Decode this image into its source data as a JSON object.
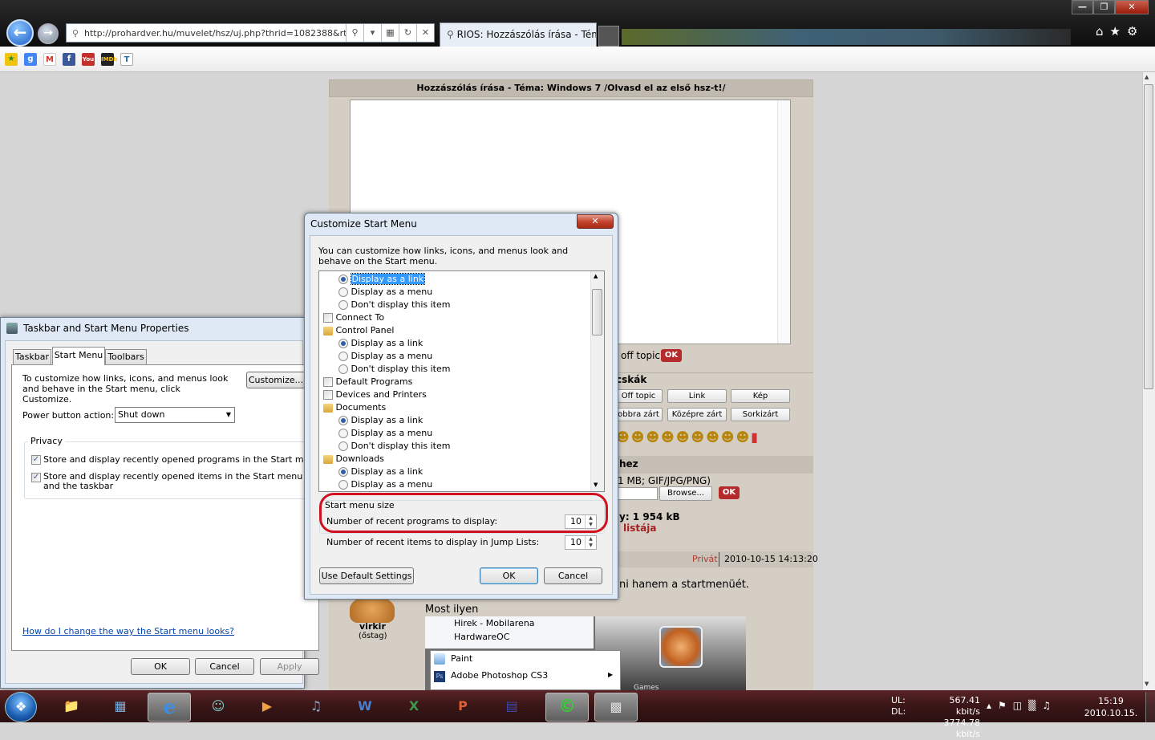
{
  "browser": {
    "address": "http://prohardver.hu/muvelet/hsz/uj.php?thrid=1082388&rto",
    "tab_title": "RIOS: Hozzászólás írása - Tém...",
    "window_buttons": [
      "—",
      "❐",
      "✕"
    ],
    "favorites": [
      "star-add-icon",
      "google-icon",
      "gmail-icon",
      "facebook-icon",
      "youtube-icon",
      "imdb-icon",
      "t-icon"
    ]
  },
  "forum": {
    "header": "Hozzászólás írása - Téma: Windows 7 /Olvasd el az első hsz-t!/",
    "offtopic_label": "off topic",
    "ok": "OK",
    "section1": "cskák",
    "buttons_row1": [
      "Off topic",
      "Link",
      "Kép"
    ],
    "buttons_row2": [
      "obbra zárt",
      "Középre zárt",
      "Sorkizárt"
    ],
    "section2": "hez",
    "upload_hint": "1 MB; GIF/JPG/PNG)",
    "browse": "Browse...",
    "size_label": "y: 1 954 kB",
    "list_link": "listája",
    "privat": "Privát",
    "timestamp": "2010-10-15 14:13:20",
    "post_text": "ni hanem a startmenüét.",
    "post_text2": "Most ilyen",
    "username": "virkir",
    "usertitle": "(őstag)",
    "menu_items_top": [
      "Hirek - Mobilarena",
      "HardwareOC"
    ],
    "menu_items": [
      "Paint",
      "Adobe Photoshop CS3"
    ],
    "games": "Games"
  },
  "taskbar_props": {
    "title": "Taskbar and Start Menu Properties",
    "tabs": [
      "Taskbar",
      "Start Menu",
      "Toolbars"
    ],
    "desc": "To customize how links, icons, and menus look and behave in the Start menu, click Customize.",
    "customize": "Customize...",
    "power_label": "Power button action:",
    "power_value": "Shut down",
    "privacy": "Privacy",
    "privacy1": "Store and display recently opened programs in the Start menu",
    "privacy2": "Store and display recently opened items in the Start menu and the taskbar",
    "help_link": "How do I change the way the Start menu looks?",
    "ok": "OK",
    "cancel": "Cancel",
    "apply": "Apply"
  },
  "customize": {
    "title": "Customize Start Menu",
    "close": "✕",
    "desc": "You can customize how links, icons, and menus look and behave on the Start menu.",
    "list": [
      {
        "type": "radio",
        "on": true,
        "label": "Display as a link",
        "sel": true
      },
      {
        "type": "radio",
        "on": false,
        "label": "Display as a menu"
      },
      {
        "type": "radio",
        "on": false,
        "label": "Don't display this item"
      },
      {
        "type": "check",
        "on": false,
        "label": "Connect To"
      },
      {
        "type": "icon",
        "label": "Control Panel"
      },
      {
        "type": "radio",
        "on": true,
        "label": "Display as a link"
      },
      {
        "type": "radio",
        "on": false,
        "label": "Display as a menu"
      },
      {
        "type": "radio",
        "on": false,
        "label": "Don't display this item"
      },
      {
        "type": "check",
        "on": false,
        "label": "Default Programs"
      },
      {
        "type": "check",
        "on": false,
        "label": "Devices and Printers"
      },
      {
        "type": "icon",
        "label": "Documents"
      },
      {
        "type": "radio",
        "on": true,
        "label": "Display as a link"
      },
      {
        "type": "radio",
        "on": false,
        "label": "Display as a menu"
      },
      {
        "type": "radio",
        "on": false,
        "label": "Don't display this item"
      },
      {
        "type": "icon",
        "label": "Downloads"
      },
      {
        "type": "radio",
        "on": true,
        "label": "Display as a link"
      },
      {
        "type": "radio",
        "on": false,
        "label": "Display as a menu"
      }
    ],
    "size_group": "Start menu size",
    "recent_programs_label": "Number of recent programs to display:",
    "recent_programs_value": "10",
    "jump_label": "Number of recent items to display in Jump Lists:",
    "jump_value": "10",
    "default_btn": "Use Default Settings",
    "ok": "OK",
    "cancel": "Cancel",
    "highlight_color": "#d0101e"
  },
  "tray": {
    "ul": "UL:",
    "dl": "DL:",
    "ul_val": "567.41 kbit/s",
    "dl_val": "3774.78 kbit/s",
    "time": "15:19",
    "date": "2010.10.15."
  }
}
